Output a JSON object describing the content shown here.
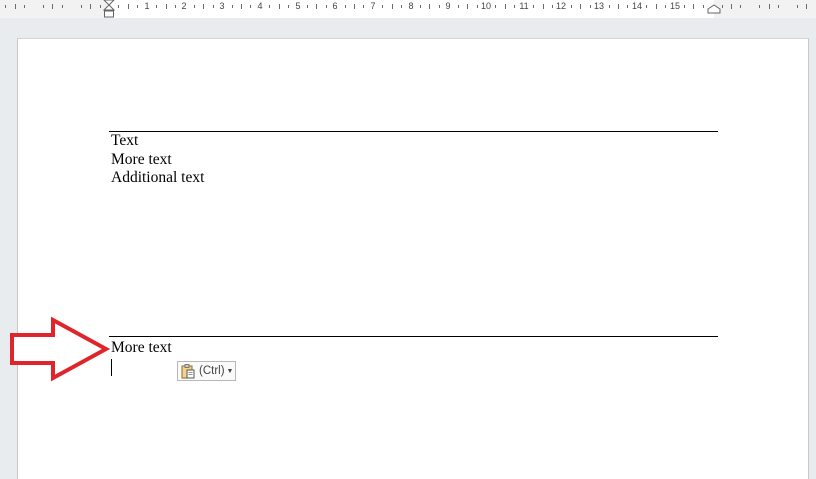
{
  "ruler": {
    "numbers": [
      "1",
      "2",
      "3",
      "4",
      "5",
      "6",
      "7",
      "8",
      "9",
      "10",
      "11",
      "12",
      "13",
      "14",
      "15"
    ]
  },
  "document": {
    "block1": {
      "lines": [
        "Text",
        "More text",
        "Additional text"
      ]
    },
    "block2": {
      "lines": [
        "More text"
      ]
    }
  },
  "paste_options": {
    "label": "(Ctrl)",
    "icon": "clipboard-paste-icon",
    "dropdown_icon": "caret-down-icon"
  },
  "annotation": {
    "icon": "red-arrow-icon",
    "color": "#e0242b"
  },
  "colors": {
    "page": "#ffffff",
    "background": "#e9ecef",
    "arrow": "#e0242b"
  }
}
